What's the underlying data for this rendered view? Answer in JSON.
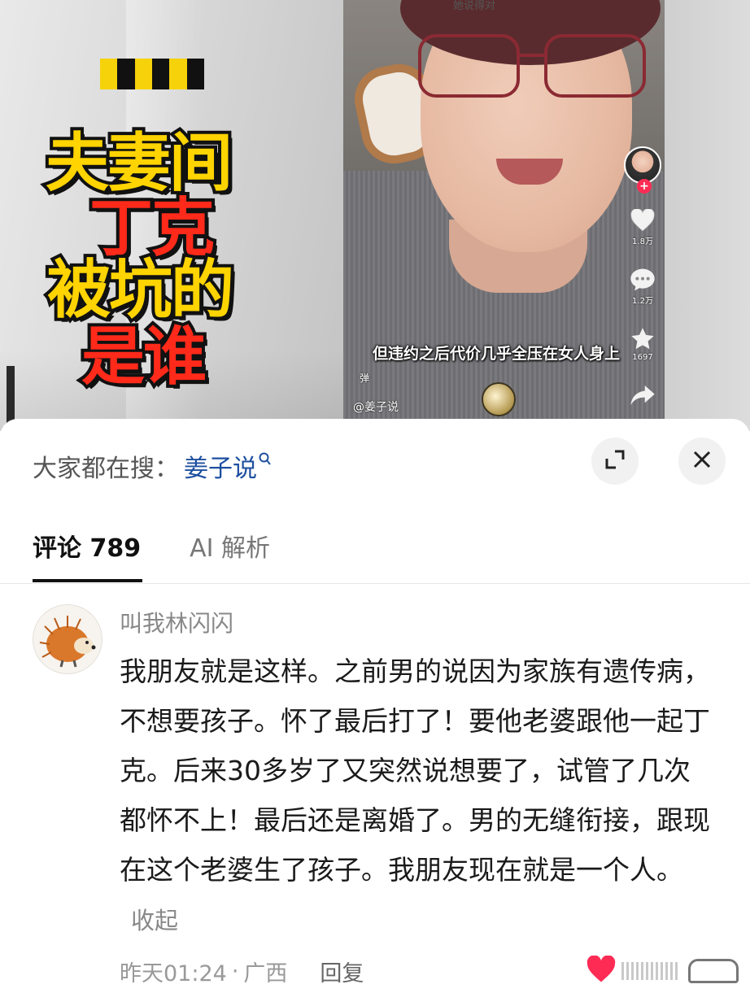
{
  "video": {
    "cover_title_lines": [
      "夫妻间",
      "丁克",
      "被坑的",
      "是谁"
    ],
    "top_caption": "她说得对",
    "subtitle": "但违约之后代价几乎全压在女人身上",
    "small_mark": "弹",
    "author_handle": "@姜子说",
    "side_actions": {
      "likes": "1.8万",
      "comments": "1.2万",
      "favorites": "1697"
    },
    "censor_colors": [
      "#f6d20a",
      "#111111",
      "#f6d20a",
      "#111111",
      "#f6d20a",
      "#111111"
    ]
  },
  "search_bar": {
    "prefix": "大家都在搜：",
    "term": "姜子说",
    "icon": "search-mini-icon"
  },
  "tabs": [
    {
      "label": "评论 789",
      "active": true
    },
    {
      "label": "AI 解析",
      "active": false
    }
  ],
  "comment": {
    "username": "叫我林闪闪",
    "text": "我朋友就是这样。之前男的说因为家族有遗传病，不想要孩子。怀了最后打了！要他老婆跟他一起丁克。后来30多岁了又突然说想要了，试管了几次都怀不上！最后还是离婚了。男的无缝衔接，跟现在这个老婆生了孩子。我朋友现在就是一个人。",
    "collapse_label": "收起",
    "time": "昨天01:24",
    "separator": "·",
    "location": "广西",
    "reply_label": "回复",
    "like_color": "#fe2c55"
  }
}
